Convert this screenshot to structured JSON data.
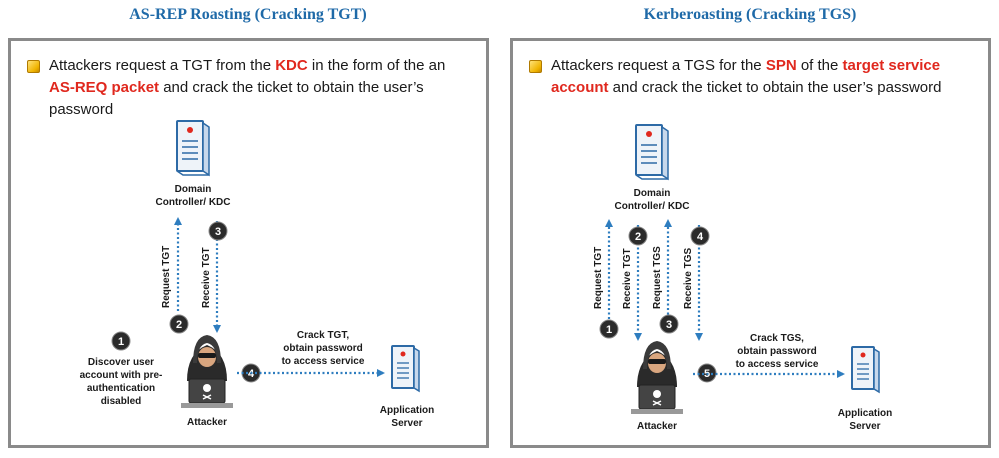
{
  "left": {
    "title": "AS-REP Roasting (Cracking TGT)",
    "bullet": {
      "pre1": "Attackers request a TGT from the ",
      "hl1": "KDC",
      "mid1": " in the form of the an ",
      "hl2": "AS-REQ packet",
      "post": " and crack the ticket to obtain the user’s password"
    },
    "dc_label": [
      "Domain",
      "Controller/ KDC"
    ],
    "attacker_label": "Attacker",
    "server_label": [
      "Application",
      "Server"
    ],
    "steps": [
      {
        "num": "1",
        "text": [
          "Discover user",
          "account with pre-",
          "authentication",
          "disabled"
        ]
      },
      {
        "num": "2",
        "text": [
          "Request TGT"
        ]
      },
      {
        "num": "3",
        "text": [
          "Receive TGT"
        ]
      },
      {
        "num": "4",
        "text": [
          "Crack TGT,",
          "obtain password",
          "to access service"
        ]
      }
    ]
  },
  "right": {
    "title": "Kerberoasting (Cracking TGS)",
    "bullet": {
      "pre1": "Attackers request a TGS for the ",
      "hl1": "SPN",
      "mid1": " of the ",
      "hl2": "target service account",
      "post": " and crack the ticket to obtain the user’s password"
    },
    "dc_label": [
      "Domain",
      "Controller/ KDC"
    ],
    "attacker_label": "Attacker",
    "server_label": [
      "Application",
      "Server"
    ],
    "steps": [
      {
        "num": "1",
        "text": [
          "Request TGT"
        ]
      },
      {
        "num": "2",
        "text": [
          "Receive TGT"
        ]
      },
      {
        "num": "3",
        "text": [
          "Request TGS"
        ]
      },
      {
        "num": "4",
        "text": [
          "Receive TGS"
        ]
      },
      {
        "num": "5",
        "text": [
          "Crack TGS,",
          "obtain password",
          "to access service"
        ]
      }
    ]
  },
  "colors": {
    "title": "#1f6aa8",
    "highlight": "#e0281e",
    "arrow": "#2e7dbf",
    "step_circle": "#2b2b2b"
  },
  "icons": [
    "server-icon",
    "hacker-icon",
    "bullet-icon"
  ]
}
